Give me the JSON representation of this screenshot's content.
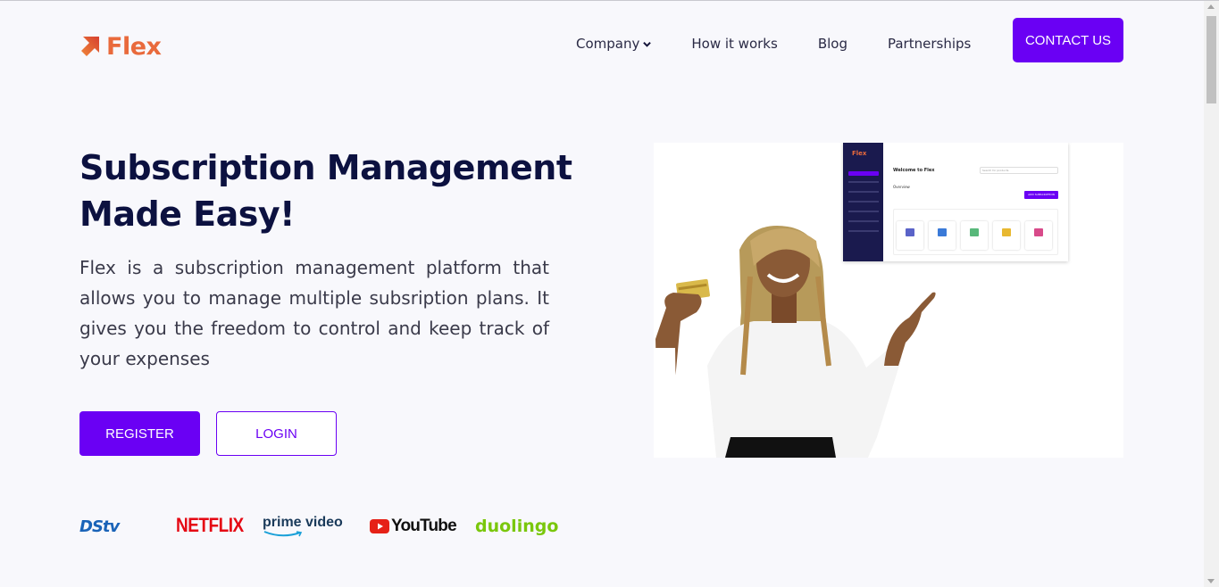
{
  "brand": {
    "name": "Flex"
  },
  "nav": {
    "items": [
      {
        "label": "Company",
        "has_dropdown": true
      },
      {
        "label": "How it works"
      },
      {
        "label": "Blog"
      },
      {
        "label": "Partnerships"
      }
    ],
    "contact_label": "CONTACT US"
  },
  "hero": {
    "title_line1": "Subscription Management",
    "title_line2": "Made Easy!",
    "description": "Flex is a subscription management platform that allows you to manage multiple subsription plans. It gives you the freedom to control and keep track of your expenses",
    "register_label": "REGISTER",
    "login_label": "LOGIN"
  },
  "partners": {
    "dstv": "DStv",
    "netflix": "NETFLIX",
    "prime": "prime video",
    "youtube": "YouTube",
    "duolingo": "duolingo"
  },
  "dashboard_preview": {
    "logo": "Flex",
    "welcome": "Welcome to Flex",
    "search_placeholder": "Search for products",
    "overview": "Overview",
    "add_button": "ADD SUBSCRIPTION"
  },
  "colors": {
    "accent": "#6a00f4",
    "brand_orange": "#e96a3c",
    "heading": "#0c1140",
    "background": "#f8f8fc"
  }
}
